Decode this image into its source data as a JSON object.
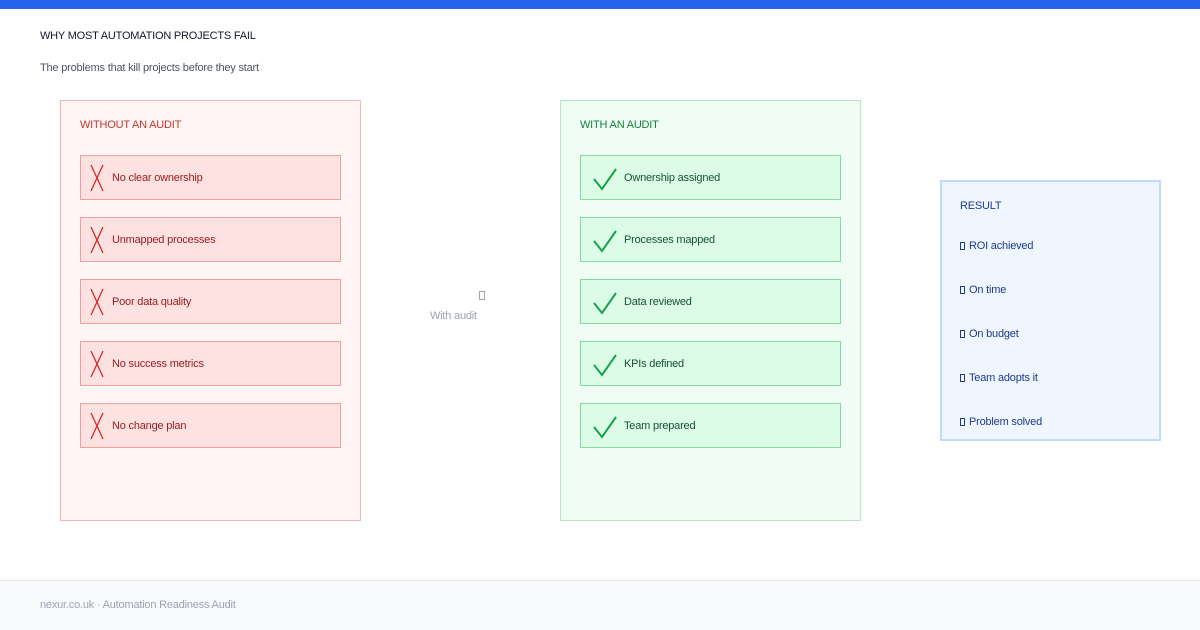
{
  "header": {
    "accent_color": "#2563eb",
    "title": "WHY MOST AUTOMATION PROJECTS FAIL",
    "subtitle": "The problems that kill projects before they start"
  },
  "without_audit": {
    "heading": "WITHOUT AN AUDIT",
    "status_icon": "cross-icon",
    "items": [
      {
        "label": "No clear ownership"
      },
      {
        "label": "Unmapped processes"
      },
      {
        "label": "Poor data quality"
      },
      {
        "label": "No success metrics"
      },
      {
        "label": "No change plan"
      }
    ]
  },
  "with_audit": {
    "heading": "WITH AN AUDIT",
    "status_icon": "check-icon",
    "items": [
      {
        "label": "Ownership assigned"
      },
      {
        "label": "Processes mapped"
      },
      {
        "label": "Data reviewed"
      },
      {
        "label": "KPIs defined"
      },
      {
        "label": "Team prepared"
      }
    ]
  },
  "transition": {
    "icon": "arrow-icon",
    "label": "With audit"
  },
  "result": {
    "heading": "RESULT",
    "items": [
      {
        "label": "ROI achieved"
      },
      {
        "label": "On time"
      },
      {
        "label": "On budget"
      },
      {
        "label": "Team adopts it"
      },
      {
        "label": "Problem solved"
      }
    ]
  },
  "footer": {
    "text": "nexur.co.uk · Automation Readiness Audit"
  },
  "colors": {
    "bad_bg": "#fee2e2",
    "bad_text": "#991b1b",
    "good_bg": "#dcfce7",
    "good_text": "#14532d",
    "result_bg": "#eff6ff",
    "result_text": "#1e3a8a"
  }
}
